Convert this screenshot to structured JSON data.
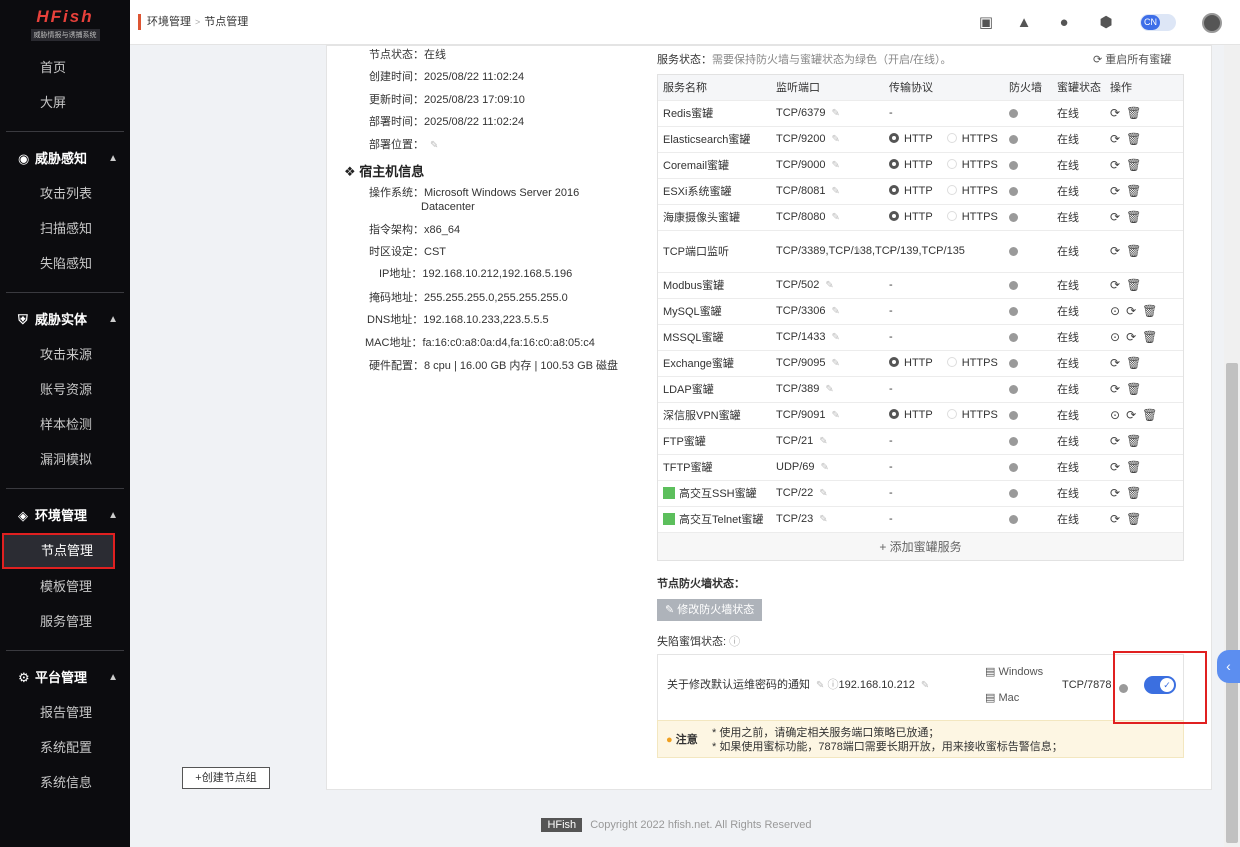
{
  "brand": {
    "logo": "HFish",
    "sub": "威胁情报与诱捕系统"
  },
  "sidebar": {
    "top": [
      {
        "label": "首页"
      },
      {
        "label": "大屏"
      }
    ],
    "groups": [
      {
        "label": "威胁感知",
        "items": [
          "攻击列表",
          "扫描感知",
          "失陷感知"
        ]
      },
      {
        "label": "威胁实体",
        "items": [
          "攻击来源",
          "账号资源",
          "样本检测",
          "漏洞模拟"
        ]
      },
      {
        "label": "环境管理",
        "items": [
          "节点管理",
          "模板管理",
          "服务管理"
        ]
      },
      {
        "label": "平台管理",
        "items": [
          "报告管理",
          "系统配置",
          "系统信息"
        ]
      }
    ]
  },
  "breadcrumb": [
    "环境管理",
    "节点管理"
  ],
  "lang": "CN",
  "node": {
    "status_label": "节点状态：",
    "status": "在线",
    "rows": [
      {
        "label": "创建时间：",
        "value": "2025/08/22 11:02:24"
      },
      {
        "label": "更新时间：",
        "value": "2025/08/23 17:09:10"
      },
      {
        "label": "部署时间：",
        "value": "2025/08/22 11:02:24"
      },
      {
        "label": "部署位置：",
        "value": ""
      }
    ]
  },
  "host": {
    "title": "宿主机信息",
    "rows": [
      {
        "label": "操作系统：",
        "value": "Microsoft Windows Server 2016 Datacenter"
      },
      {
        "label": "指令架构：",
        "value": "x86_64"
      },
      {
        "label": "时区设定：",
        "value": "CST"
      },
      {
        "label": "IP地址：",
        "value": "192.168.10.212,192.168.5.196"
      },
      {
        "label": "掩码地址：",
        "value": "255.255.255.0,255.255.255.0"
      },
      {
        "label": "DNS地址：",
        "value": "192.168.10.233,223.5.5.5"
      },
      {
        "label": "MAC地址：",
        "value": "fa:16:c0:a8:0a:d4,fa:16:c0:a8:05:c4"
      },
      {
        "label": "硬件配置：",
        "value": "8 cpu | 16.00 GB 内存 | 100.53 GB 磁盘"
      }
    ]
  },
  "create_group": "+创建节点组",
  "svc_status": {
    "label": "服务状态：",
    "hint": "需要保持防火墙与蜜罐状态为绿色（开启/在线）。",
    "restart": "重启所有蜜罐"
  },
  "table": {
    "headers": [
      "服务名称",
      "监听端口",
      "传输协议",
      "防火墙",
      "蜜罐状态",
      "操作"
    ],
    "rows": [
      {
        "name": "Redis蜜罐",
        "port": "TCP/6379",
        "proto": "-",
        "status": "在线"
      },
      {
        "name": "Elasticsearch蜜罐",
        "port": "TCP/9200",
        "proto": "http",
        "status": "在线"
      },
      {
        "name": "Coremail蜜罐",
        "port": "TCP/9000",
        "proto": "http",
        "status": "在线"
      },
      {
        "name": "ESXi系统蜜罐",
        "port": "TCP/8081",
        "proto": "http",
        "status": "在线"
      },
      {
        "name": "海康摄像头蜜罐",
        "port": "TCP/8080",
        "proto": "http",
        "status": "在线"
      },
      {
        "name": "TCP端口监听",
        "port": "TCP/3389,TCP/138,TCP/139,TCP/135",
        "proto": "-",
        "status": "在线"
      },
      {
        "name": "Modbus蜜罐",
        "port": "TCP/502",
        "proto": "-",
        "status": "在线"
      },
      {
        "name": "MySQL蜜罐",
        "port": "TCP/3306",
        "proto": "-",
        "status": "在线",
        "extra": true
      },
      {
        "name": "MSSQL蜜罐",
        "port": "TCP/1433",
        "proto": "-",
        "status": "在线",
        "extra": true
      },
      {
        "name": "Exchange蜜罐",
        "port": "TCP/9095",
        "proto": "http",
        "status": "在线"
      },
      {
        "name": "LDAP蜜罐",
        "port": "TCP/389",
        "proto": "-",
        "status": "在线"
      },
      {
        "name": "深信服VPN蜜罐",
        "port": "TCP/9091",
        "proto": "http",
        "status": "在线",
        "extra": true
      },
      {
        "name": "FTP蜜罐",
        "port": "TCP/21",
        "proto": "-",
        "status": "在线"
      },
      {
        "name": "TFTP蜜罐",
        "port": "UDP/69",
        "proto": "-",
        "status": "在线"
      },
      {
        "name": "高交互SSH蜜罐",
        "port": "TCP/22",
        "proto": "-",
        "status": "在线",
        "hi": true
      },
      {
        "name": "高交互Telnet蜜罐",
        "port": "TCP/23",
        "proto": "-",
        "status": "在线",
        "hi": true
      }
    ],
    "http": "HTTP",
    "https": "HTTPS",
    "add": "添加蜜罐服务"
  },
  "firewall": {
    "label": "节点防火墙状态：",
    "button": "修改防火墙状态"
  },
  "lure": {
    "label": "失陷蜜饵状态:",
    "name": "关于修改默认运维密码的通知",
    "ip": "192.168.10.212",
    "win": "Windows",
    "mac": "Mac",
    "port": "TCP/7878"
  },
  "note": {
    "label": "注意",
    "lines": [
      "* 使用之前，请确定相关服务端口策略已放通；",
      "* 如果使用蜜标功能，7878端口需要长期开放，用来接收蜜标告警信息；"
    ]
  },
  "footer": {
    "tag": "HFish",
    "text": "Copyright 2022 hfish.net. All Rights Reserved"
  }
}
